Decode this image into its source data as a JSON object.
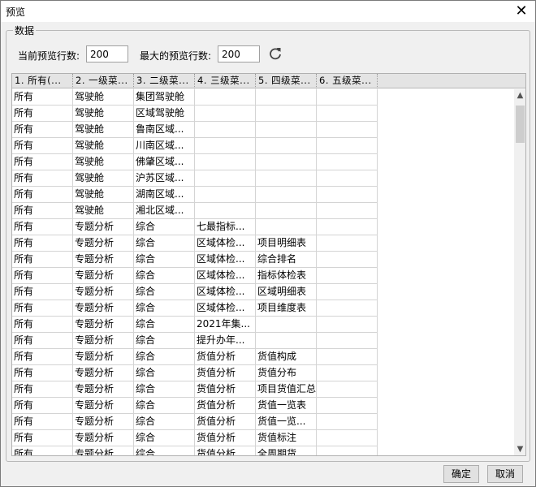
{
  "window": {
    "title": "预览",
    "close_glyph": "✕"
  },
  "group": {
    "legend": "数据"
  },
  "fields": {
    "current_label": "当前预览行数:",
    "current_value": "200",
    "max_label": "最大的预览行数:",
    "max_value": "200"
  },
  "table": {
    "columns": [
      "1. 所有(...",
      "2. 一级菜...",
      "3. 二级菜...",
      "4. 三级菜...",
      "5. 四级菜...",
      "6. 五级菜..."
    ],
    "rows": [
      [
        "所有",
        "驾驶舱",
        "集团驾驶舱",
        "",
        "",
        ""
      ],
      [
        "所有",
        "驾驶舱",
        "区域驾驶舱",
        "",
        "",
        ""
      ],
      [
        "所有",
        "驾驶舱",
        "鲁南区域...",
        "",
        "",
        ""
      ],
      [
        "所有",
        "驾驶舱",
        "川南区域...",
        "",
        "",
        ""
      ],
      [
        "所有",
        "驾驶舱",
        "佛肇区域...",
        "",
        "",
        ""
      ],
      [
        "所有",
        "驾驶舱",
        "沪苏区域...",
        "",
        "",
        ""
      ],
      [
        "所有",
        "驾驶舱",
        "湖南区域...",
        "",
        "",
        ""
      ],
      [
        "所有",
        "驾驶舱",
        "湘北区域...",
        "",
        "",
        ""
      ],
      [
        "所有",
        "专题分析",
        "综合",
        "七最指标...",
        "",
        ""
      ],
      [
        "所有",
        "专题分析",
        "综合",
        "区域体检...",
        "项目明细表",
        ""
      ],
      [
        "所有",
        "专题分析",
        "综合",
        "区域体检...",
        "综合排名",
        ""
      ],
      [
        "所有",
        "专题分析",
        "综合",
        "区域体检...",
        "指标体检表",
        ""
      ],
      [
        "所有",
        "专题分析",
        "综合",
        "区域体检...",
        "区域明细表",
        ""
      ],
      [
        "所有",
        "专题分析",
        "综合",
        "区域体检...",
        "项目维度表",
        ""
      ],
      [
        "所有",
        "专题分析",
        "综合",
        "2021年集...",
        "",
        ""
      ],
      [
        "所有",
        "专题分析",
        "综合",
        "提升办年...",
        "",
        ""
      ],
      [
        "所有",
        "专题分析",
        "综合",
        "货值分析",
        "货值构成",
        ""
      ],
      [
        "所有",
        "专题分析",
        "综合",
        "货值分析",
        "货值分布",
        ""
      ],
      [
        "所有",
        "专题分析",
        "综合",
        "货值分析",
        "项目货值汇总",
        ""
      ],
      [
        "所有",
        "专题分析",
        "综合",
        "货值分析",
        "货值一览表",
        ""
      ],
      [
        "所有",
        "专题分析",
        "综合",
        "货值分析",
        "货值一览...",
        ""
      ],
      [
        "所有",
        "专题分析",
        "综合",
        "货值分析",
        "货值标注",
        ""
      ],
      [
        "所有",
        "专题分析",
        "综合",
        "货值分析",
        "全周期货...",
        ""
      ]
    ]
  },
  "scrollbar": {
    "up": "▲",
    "down": "▼"
  },
  "buttons": {
    "ok": "确定",
    "cancel": "取消"
  }
}
